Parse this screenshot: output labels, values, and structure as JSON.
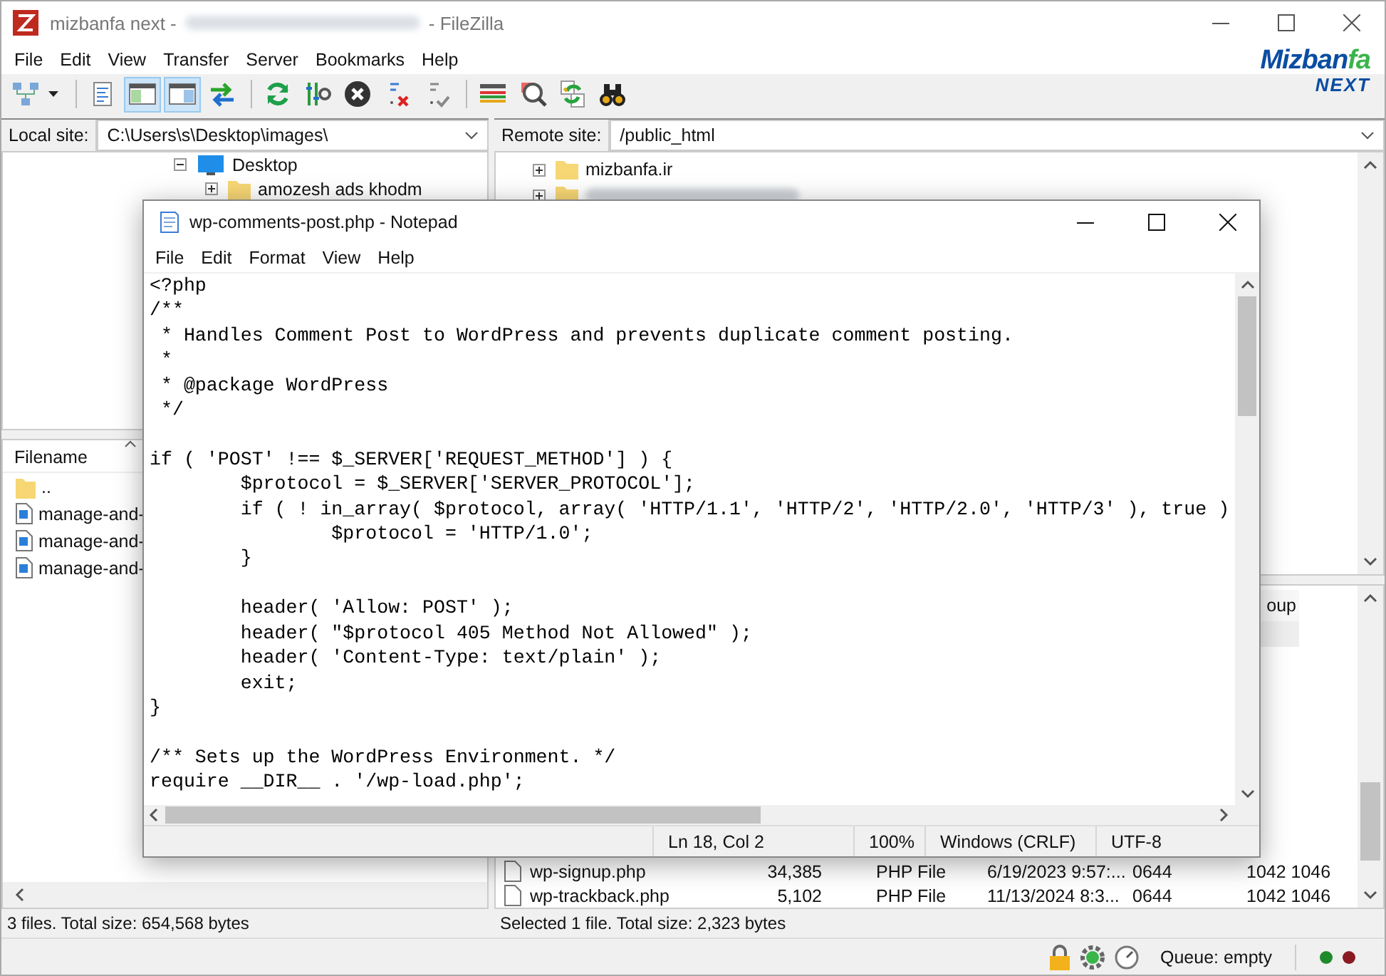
{
  "window": {
    "title_start": "mizbanfa next -",
    "title_end": "- FileZilla"
  },
  "menu": [
    "File",
    "Edit",
    "View",
    "Transfer",
    "Server",
    "Bookmarks",
    "Help"
  ],
  "logo": {
    "main": "Mizban",
    "accent": "fa",
    "tagline": "NEXT"
  },
  "toolbar": [
    {
      "pressed": false
    },
    {
      "pressed": false
    },
    {
      "pressed": true
    },
    {
      "pressed": true
    },
    {
      "pressed": false
    },
    {
      "pressed": false
    },
    {
      "pressed": false
    },
    {
      "pressed": false
    },
    {
      "pressed": false
    },
    {
      "pressed": false
    },
    {
      "pressed": false
    },
    {
      "pressed": false
    },
    {
      "pressed": false
    },
    {
      "pressed": false
    }
  ],
  "local": {
    "label": "Local site:",
    "path": "C:\\Users\\s\\Desktop\\images\\",
    "tree": [
      {
        "label": "Desktop",
        "expanded": true,
        "children": [
          {
            "label": "amozesh ads khodm",
            "expanded": false
          }
        ]
      }
    ],
    "list_header": "Filename",
    "files": [
      {
        "name": "..",
        "kind": "folder"
      },
      {
        "name": "manage-and-",
        "kind": "image"
      },
      {
        "name": "manage-and-",
        "kind": "image"
      },
      {
        "name": "manage-and-",
        "kind": "image"
      }
    ],
    "status": "3 files. Total size: 654,568 bytes"
  },
  "remote": {
    "label": "Remote site:",
    "path": "/public_html",
    "tree": [
      {
        "label": "mizbanfa.ir",
        "expanded": false,
        "redacted": false
      },
      {
        "expanded": false,
        "redacted": true
      }
    ],
    "header_fragment": "oup",
    "files": [
      {
        "name": "wp-signup.php",
        "size": "34,385",
        "type": "PHP File",
        "modified": "6/19/2023 9:57:...",
        "permissions": "0644",
        "owner": "1042 1046"
      },
      {
        "name": "wp-trackback.php",
        "size": "5,102",
        "type": "PHP File",
        "modified": "11/13/2024 8:3...",
        "permissions": "0644",
        "owner": "1042 1046"
      }
    ],
    "status": "Selected 1 file. Total size: 2,323 bytes"
  },
  "queue": "Queue: empty",
  "notepad": {
    "title": "wp-comments-post.php - Notepad",
    "menu": [
      "File",
      "Edit",
      "Format",
      "View",
      "Help"
    ],
    "code": "<?php\n/**\n * Handles Comment Post to WordPress and prevents duplicate comment posting.\n *\n * @package WordPress\n */\n\nif ( 'POST' !== $_SERVER['REQUEST_METHOD'] ) {\n\t$protocol = $_SERVER['SERVER_PROTOCOL'];\n\tif ( ! in_array( $protocol, array( 'HTTP/1.1', 'HTTP/2', 'HTTP/2.0', 'HTTP/3' ), true )\n\t\t$protocol = 'HTTP/1.0';\n\t}\n\n\theader( 'Allow: POST' );\n\theader( \"$protocol 405 Method Not Allowed\" );\n\theader( 'Content-Type: text/plain' );\n\texit;\n}\n\n/** Sets up the WordPress Environment. */\nrequire __DIR__ . '/wp-load.php';",
    "status": {
      "position": "Ln 18, Col 2",
      "zoom": "100%",
      "line_endings": "Windows (CRLF)",
      "encoding": "UTF-8"
    }
  }
}
